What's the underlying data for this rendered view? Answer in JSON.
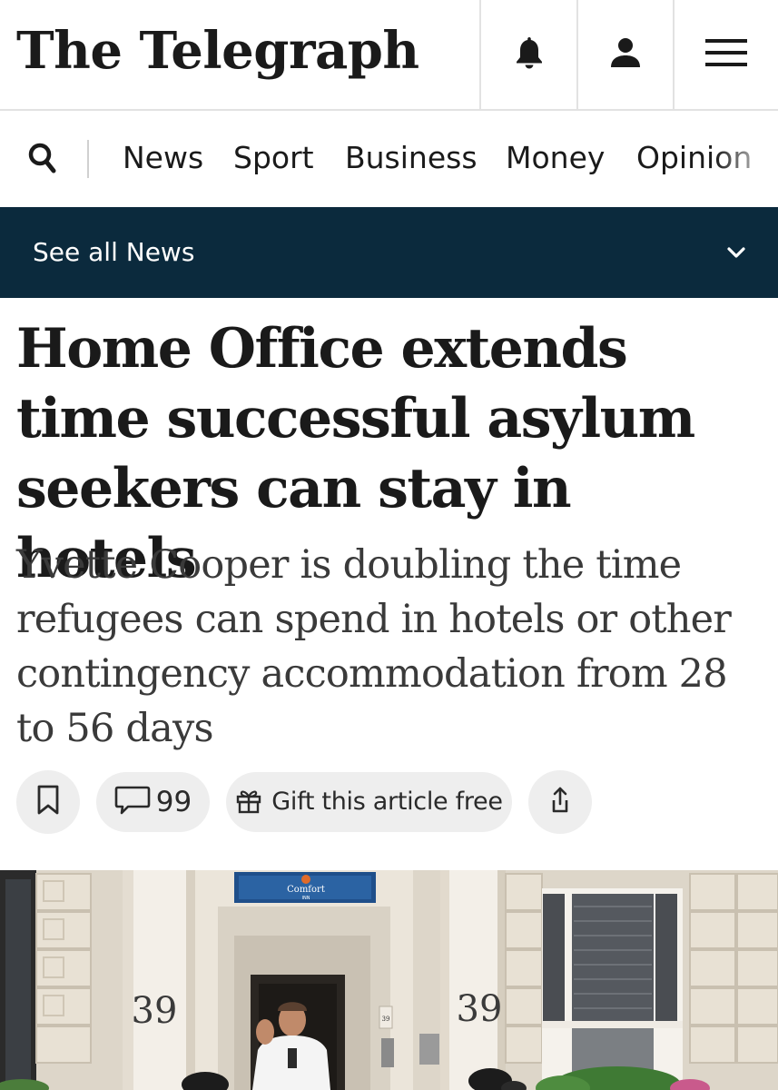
{
  "masthead": {
    "logo_text": "The Telegraph",
    "icons": [
      "bell-icon",
      "user-icon",
      "menu-icon"
    ]
  },
  "nav": {
    "search_icon": "search-icon",
    "items": [
      "News",
      "Sport",
      "Business",
      "Money",
      "Opinion"
    ]
  },
  "section_bar": {
    "label": "See all News",
    "icon": "chevron-down-icon",
    "background": "#0b2a3d"
  },
  "article": {
    "headline": "Home Office extends time successful asylum seekers can stay in hotels",
    "standfirst": "Yvette Cooper is doubling the time refugees can spend in hotels or other contingency accommodation from 28 to 56 days"
  },
  "actions": {
    "bookmark_icon": "bookmark-icon",
    "comments_count": "99",
    "comments_icon": "comment-icon",
    "gift_label": "Gift this article free",
    "gift_icon": "gift-icon",
    "share_icon": "share-icon"
  },
  "hero_image": {
    "sign_text": "Comfort",
    "sign_subtext": "INN",
    "door_numbers": [
      "39",
      "39"
    ],
    "small_number": "39"
  }
}
